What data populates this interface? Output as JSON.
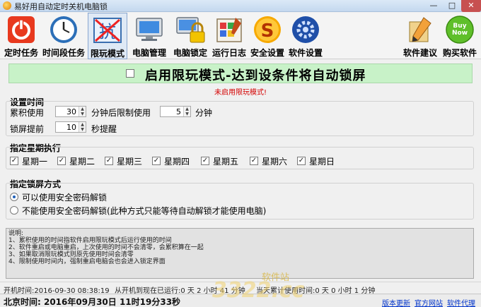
{
  "window": {
    "title": "易好用自动定时关机电脑锁",
    "minimize": "—",
    "maximize": "□",
    "close": "✕"
  },
  "toolbar": {
    "items": [
      {
        "label": "定时任务",
        "icon": "power-icon"
      },
      {
        "label": "时间段任务",
        "icon": "clock-icon"
      },
      {
        "label": "限玩模式",
        "icon": "restrict-icon"
      },
      {
        "label": "电脑管理",
        "icon": "monitor-icon"
      },
      {
        "label": "电脑锁定",
        "icon": "lock-icon"
      },
      {
        "label": "运行日志",
        "icon": "log-icon"
      },
      {
        "label": "安全设置",
        "icon": "safe-icon"
      },
      {
        "label": "软件设置",
        "icon": "gear-icon"
      },
      {
        "label": "软件建议",
        "icon": "pencil-icon"
      },
      {
        "label": "购买软件",
        "icon": "buy-now-icon"
      }
    ],
    "buy_badge": "Buy Now"
  },
  "banner": {
    "text": "启用限玩模式-达到设条件将自动锁屏",
    "checked": false
  },
  "status_message": "未启用限玩模式!",
  "time_settings": {
    "title": "设置时间",
    "accum_label": "累积使用",
    "accum_value": "30",
    "after_label": "分钟后限制使用",
    "limit_value": "5",
    "minute_label": "分钟",
    "remind_label": "锁屏提前",
    "remind_value": "10",
    "seconds_label": "秒提醒"
  },
  "weekdays": {
    "title": "指定星期执行",
    "days": [
      {
        "label": "星期一",
        "checked": true
      },
      {
        "label": "星期二",
        "checked": true
      },
      {
        "label": "星期三",
        "checked": true
      },
      {
        "label": "星期四",
        "checked": true
      },
      {
        "label": "星期五",
        "checked": true
      },
      {
        "label": "星期六",
        "checked": true
      },
      {
        "label": "星期日",
        "checked": true
      }
    ]
  },
  "lock_method": {
    "title": "指定锁屏方式",
    "options": [
      {
        "label": "可以使用安全密码解锁",
        "selected": true
      },
      {
        "label": "不能使用安全密码解锁(此种方式只能等待自动解锁才能使用电脑)",
        "selected": false
      }
    ]
  },
  "notes": {
    "lines": [
      "说明:",
      "1、累积使用的时间指软件启用限玩模式后运行使用的时间",
      "2、软件重启或电脑重启，上次使用的时间不会清零，会累积算在一起",
      "3、如果取消限玩模式则原先使用时间会清零",
      "4、限制使用时间内，强制重启电脑会也会进入锁定界面"
    ]
  },
  "status": {
    "boot_time": "开机时间:2016-09-30 08:38:19",
    "since_boot": "从开机到现在已运行:0 天 2 小时 41 分钟",
    "today_total": "当天累计使用时间:0 天 0 小时 1 分钟",
    "clock": "北京时间: 2016年09月30日  11时19分33秒",
    "links": [
      "版本更新",
      "官方网站",
      "软件代理"
    ]
  },
  "watermark": {
    "text": "3322.cc",
    "sub": "软件站"
  }
}
